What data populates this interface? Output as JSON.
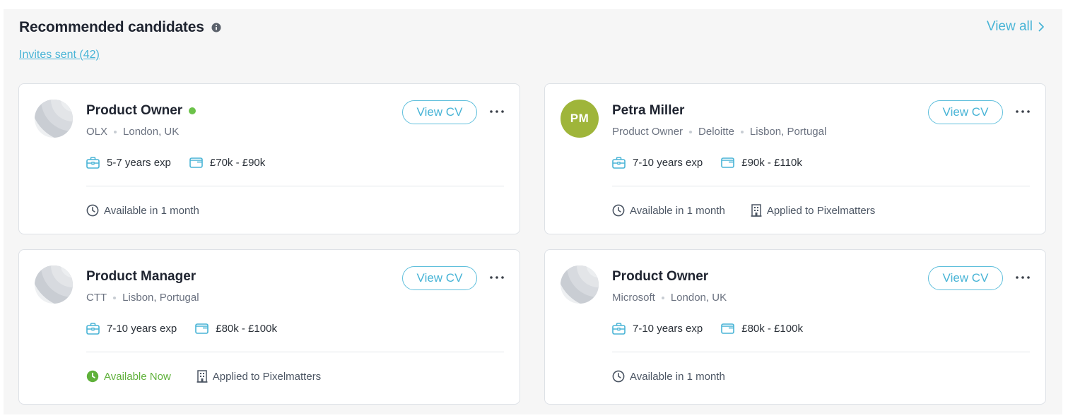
{
  "header": {
    "title": "Recommended candidates",
    "invites_link": "Invites sent (42)",
    "view_all": "View all"
  },
  "colors": {
    "accent": "#48b4d6",
    "available_now": "#5fb13a",
    "online_dot": "#6cc24a",
    "initials_avatar": "#9fb53a"
  },
  "actions": {
    "view_cv": "View CV"
  },
  "candidates": [
    {
      "avatar": "placeholder",
      "title": "Product Owner",
      "online": true,
      "meta": [
        "OLX",
        "London, UK"
      ],
      "experience": "5-7 years exp",
      "salary": "£70k - £90k",
      "availability": "Available in 1 month",
      "available_now": false,
      "applied": ""
    },
    {
      "avatar": "initials",
      "initials": "PM",
      "title": "Petra Miller",
      "online": false,
      "meta": [
        "Product Owner",
        "Deloitte",
        "Lisbon, Portugal"
      ],
      "experience": "7-10 years exp",
      "salary": "£90k - £110k",
      "availability": "Available in 1 month",
      "available_now": false,
      "applied": "Applied to Pixelmatters"
    },
    {
      "avatar": "placeholder",
      "title": "Product Manager",
      "online": false,
      "meta": [
        "CTT",
        "Lisbon, Portugal"
      ],
      "experience": "7-10 years exp",
      "salary": "£80k - £100k",
      "availability": "Available Now",
      "available_now": true,
      "applied": "Applied to Pixelmatters"
    },
    {
      "avatar": "placeholder",
      "title": "Product Owner",
      "online": false,
      "meta": [
        "Microsoft",
        "London, UK"
      ],
      "experience": "7-10 years exp",
      "salary": "£80k - £100k",
      "availability": "Available in 1 month",
      "available_now": false,
      "applied": ""
    }
  ]
}
